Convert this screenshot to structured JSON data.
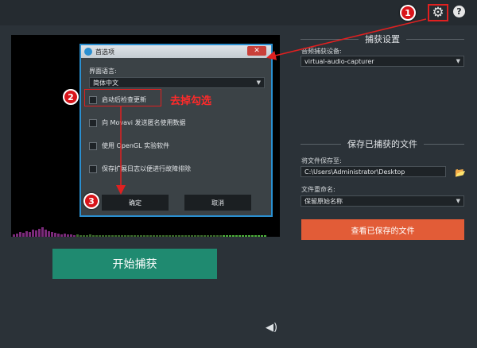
{
  "topbar": {
    "settings_icon": "gear-icon",
    "help_icon": "help-icon",
    "help_glyph": "?",
    "gear_glyph": "⚙"
  },
  "annotations": {
    "step1": "1",
    "step2": "2",
    "step3": "3",
    "note": "去掉勾选",
    "accent": "#e02020"
  },
  "capture": {
    "section_title": "捕获设置",
    "audio_device_label": "音频捕获设备:",
    "audio_device_value": "virtual-audio-capturer"
  },
  "saved": {
    "section_title": "保存已捕获的文件",
    "save_to_label": "将文件保存至:",
    "save_to_value": "C:\\Users\\Administrator\\Desktop",
    "rename_label": "文件重命名:",
    "rename_value": "保留原始名称",
    "view_button": "查看已保存的文件"
  },
  "main": {
    "start_button": "开始捕获",
    "start_color": "#1f8a70",
    "view_color": "#e25c37"
  },
  "dialog": {
    "title": "首选项",
    "close_glyph": "✕",
    "language_label": "界面语言:",
    "language_value": "简体中文",
    "options": [
      {
        "label": "启动后检查更新",
        "checked": false
      },
      {
        "label": "向 Movavi 发送匿名使用数据",
        "checked": false
      },
      {
        "label": "使用 OpenGL 实验软件",
        "checked": false
      },
      {
        "label": "保存扩展日志以便进行故障排除",
        "checked": false
      }
    ],
    "ok_button": "确定",
    "cancel_button": "取消"
  }
}
